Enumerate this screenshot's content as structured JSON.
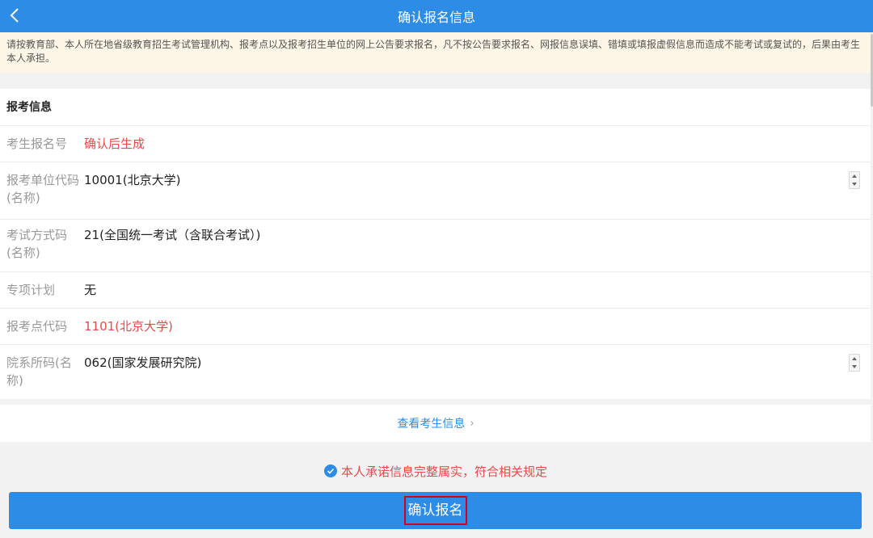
{
  "header": {
    "title": "确认报名信息",
    "back_icon": "chevron-left-icon"
  },
  "notice": {
    "text": "请按教育部、本人所在地省级教育招生考试管理机构、报考点以及报考招生单位的网上公告要求报名，凡不按公告要求报名、网报信息误填、错填或填报虚假信息而造成不能考试或复试的，后果由考生本人承担。"
  },
  "section": {
    "title": "报考信息",
    "rows": [
      {
        "label": "考生报名号",
        "value": "确认后生成"
      },
      {
        "label": "报考单位代码(名称)",
        "value": "10001(北京大学)"
      },
      {
        "label": "考试方式码(名称)",
        "value": "21(全国统一考试（含联合考试）)"
      },
      {
        "label": "专项计划",
        "value": "无"
      },
      {
        "label": "报考点代码",
        "value": "1101(北京大学)"
      },
      {
        "label": "院系所码(名称)",
        "value": "062(国家发展研究院)"
      }
    ]
  },
  "view_link": {
    "label": "查看考生信息",
    "chevron": "›"
  },
  "agreement": {
    "text": "本人承诺信息完整属实，符合相关规定",
    "icon": "check-circle-icon"
  },
  "confirm_button": {
    "label": "确认报名"
  },
  "colors": {
    "brand": "#2d8ce6",
    "alert": "#e84a4a",
    "notice_bg": "#fdf6e6"
  }
}
